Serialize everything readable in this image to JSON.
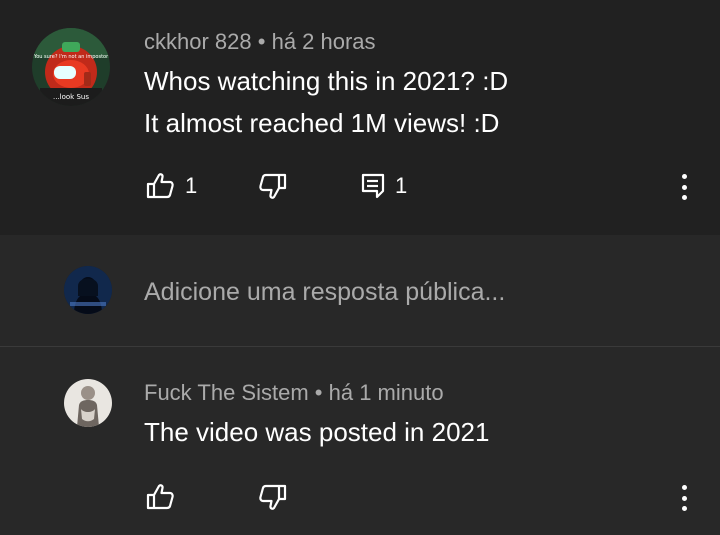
{
  "comment": {
    "author": "ckkhor 828",
    "separator": "•",
    "time": "há 2 horas",
    "lines": [
      "Whos watching this in 2021? :D",
      "It almost reached 1M views! :D"
    ],
    "like_count": "1",
    "reply_count": "1",
    "avatar_text_top": "You sure? I'm not an impostor",
    "avatar_text_bottom": "...look Sus"
  },
  "reply_input": {
    "placeholder": "Adicione uma resposta pública..."
  },
  "reply": {
    "author": "Fuck The Sistem",
    "separator": "•",
    "time": "há 1 minuto",
    "text": "The video was posted in 2021"
  },
  "colors": {
    "background": "#212121",
    "panel": "#282828",
    "secondary_text": "#aaaaaa",
    "primary_text": "#ffffff"
  },
  "icons": [
    "thumb-up-icon",
    "thumb-down-icon",
    "reply-icon",
    "more-vert-icon"
  ]
}
